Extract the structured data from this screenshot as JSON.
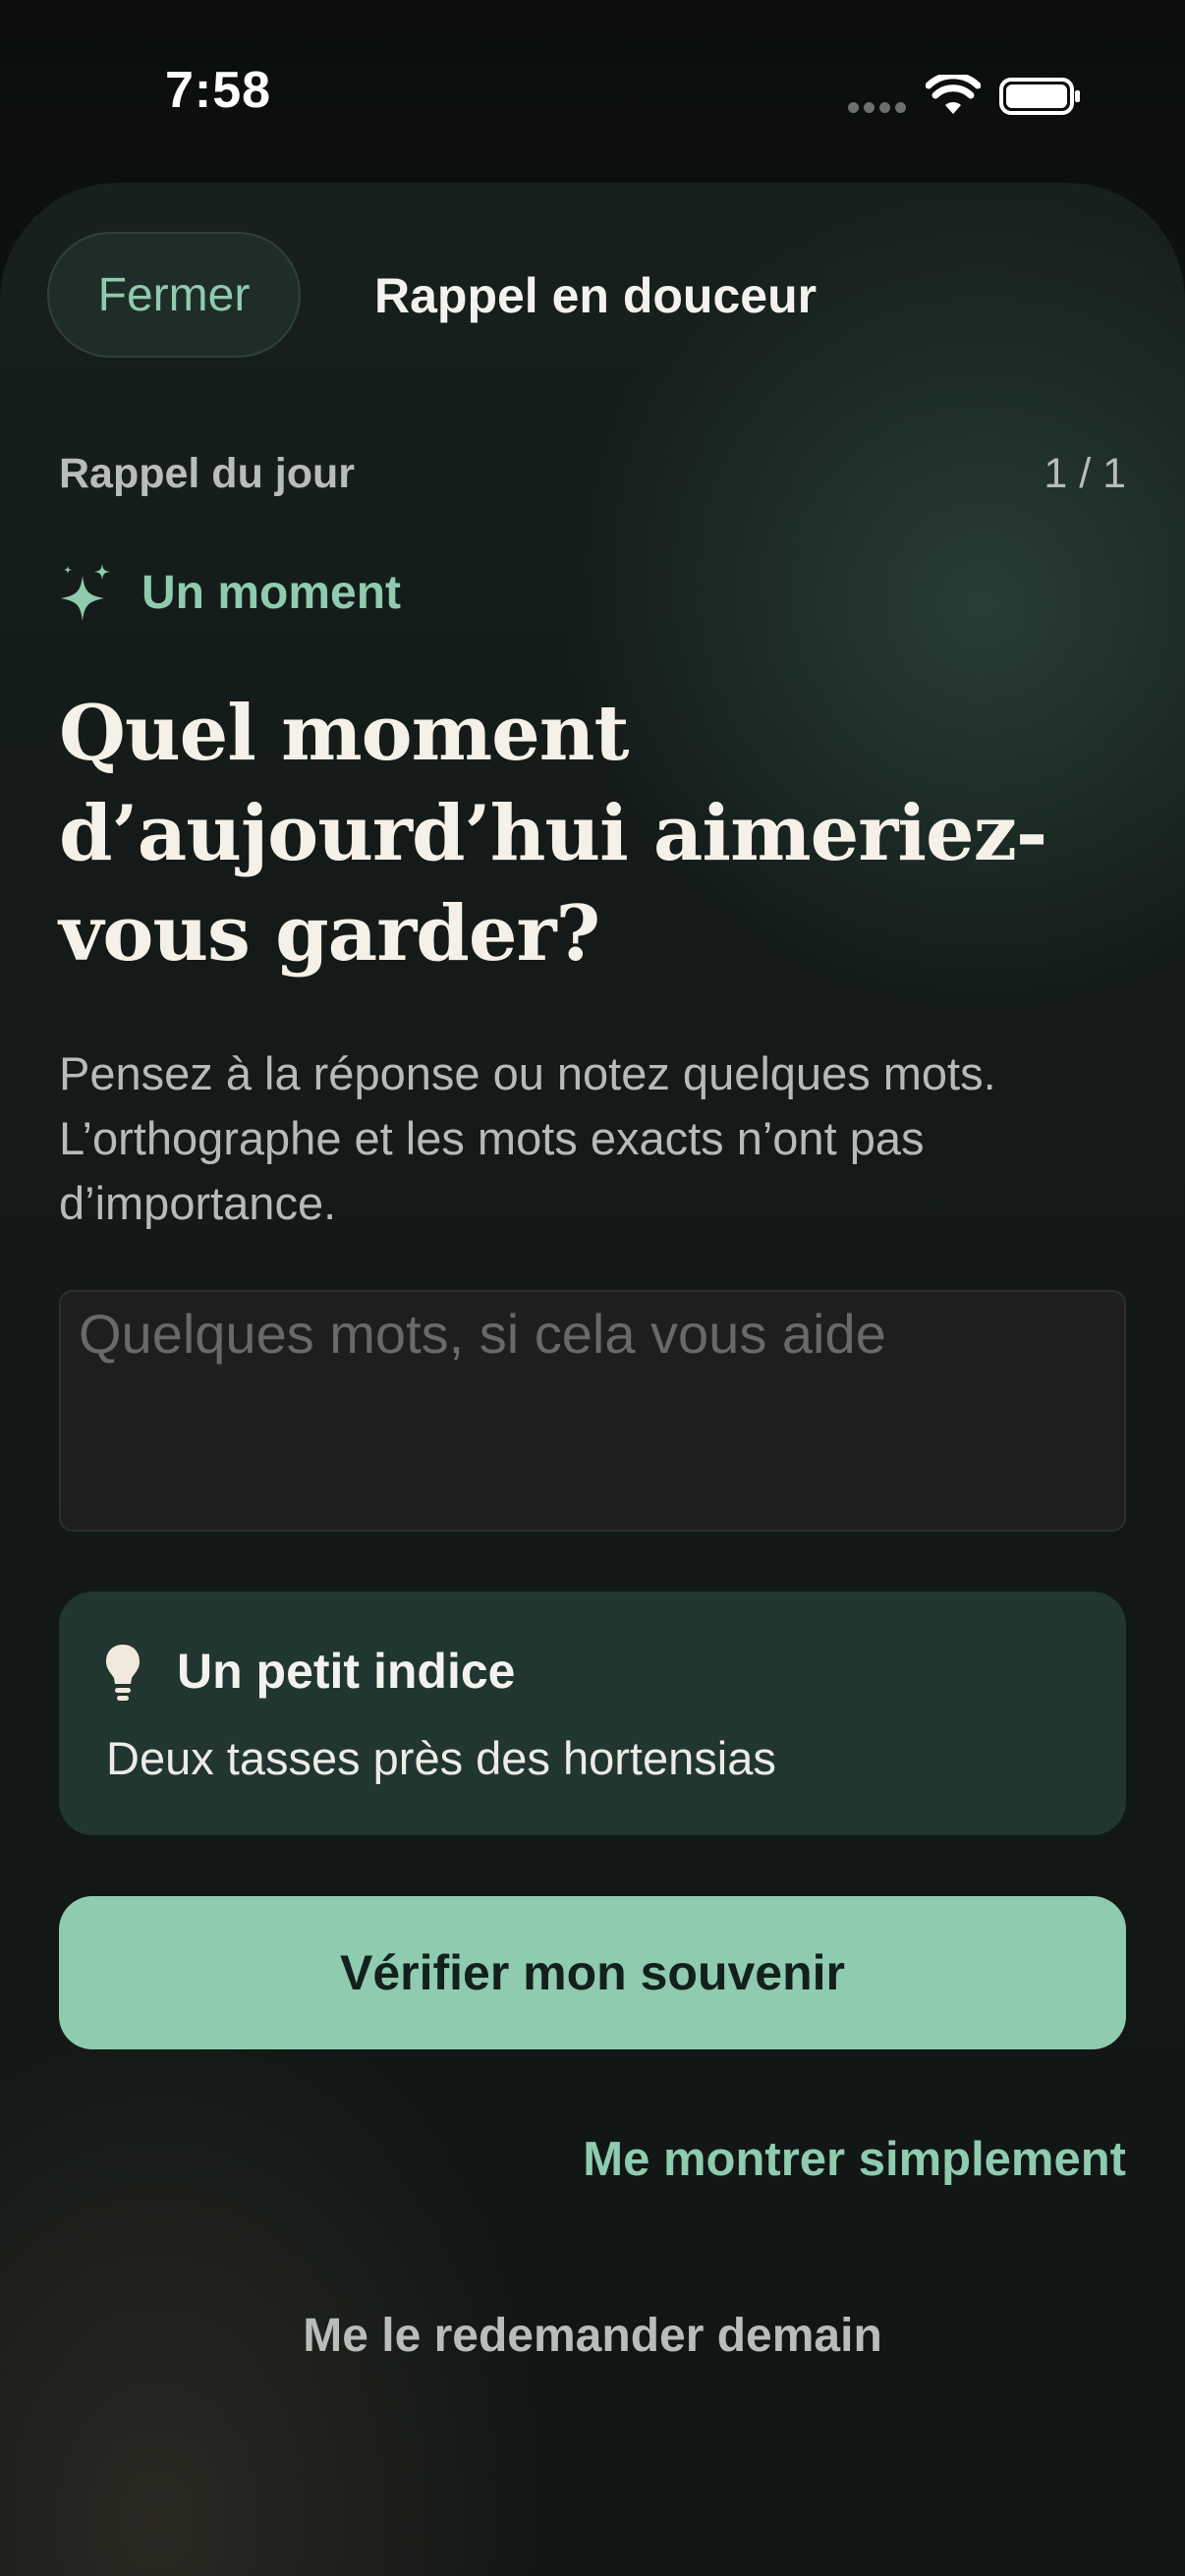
{
  "status_bar": {
    "time": "7:58",
    "icons": [
      "cellular-signal-icon",
      "wifi-icon",
      "battery-icon"
    ]
  },
  "header": {
    "close_label": "Fermer",
    "title": "Rappel en douceur"
  },
  "session": {
    "label": "Rappel du jour",
    "counter": "1 / 1"
  },
  "category": {
    "icon": "sparkle-icon",
    "label": "Un moment"
  },
  "question": "Quel moment d’aujourd’hui aimeriez-vous garder?",
  "instruction": "Pensez à la réponse ou notez quelques mots. L’orthographe et les mots exacts n’ont pas d’importance.",
  "answer_field": {
    "value": "",
    "placeholder": "Quelques mots, si cela vous aide"
  },
  "hint": {
    "icon": "lightbulb-icon",
    "title": "Un petit indice",
    "text": "Deux tasses près des hortensias"
  },
  "actions": {
    "primary_label": "Vérifier mon souvenir",
    "show_label": "Me montrer simplement",
    "later_label": "Me le redemander demain"
  },
  "colors": {
    "accent": "#8fcbae",
    "hint_background": "#213630",
    "background": "#111614",
    "question_text": "#f5f1e8"
  }
}
